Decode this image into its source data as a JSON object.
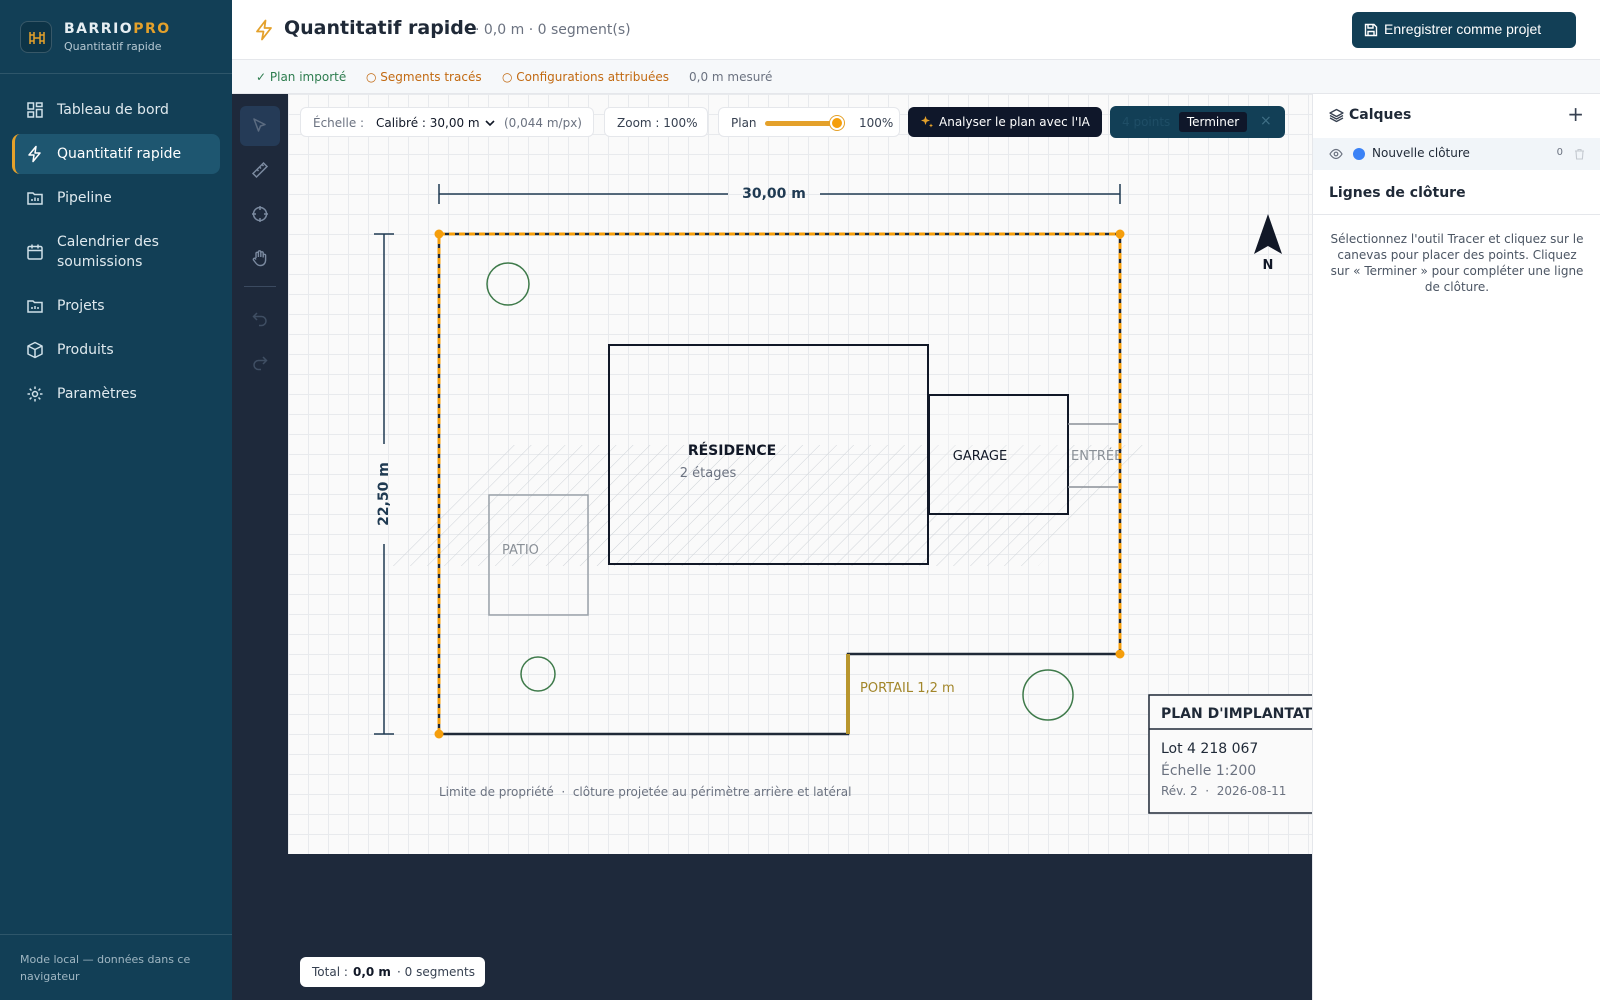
{
  "brand": {
    "name_part1": "BARRIO",
    "name_part2": "PRO",
    "subtitle": "Quantitatif rapide"
  },
  "sidebar": {
    "items": [
      {
        "label": "Tableau de bord",
        "icon": "dashboard-icon",
        "active": false
      },
      {
        "label": "Quantitatif rapide",
        "icon": "bolt-icon",
        "active": true
      },
      {
        "label": "Pipeline",
        "icon": "pipeline-icon",
        "active": false
      },
      {
        "label": "Calendrier des soumissions",
        "icon": "calendar-icon",
        "active": false
      },
      {
        "label": "Projets",
        "icon": "folder-icon",
        "active": false
      },
      {
        "label": "Produits",
        "icon": "box-icon",
        "active": false
      },
      {
        "label": "Paramètres",
        "icon": "gear-icon",
        "active": false
      }
    ],
    "footer": "Mode local — données dans ce navigateur"
  },
  "header": {
    "title": "Quantitatif rapide",
    "meta": "· 0,0 m · 0 segment(s)",
    "save_label": "Enregistrer comme projet"
  },
  "status": {
    "step1": "✓ Plan importé",
    "step2": "○ Segments tracés",
    "step3": "○ Configurations attribuées",
    "measured": "0,0 m mesuré"
  },
  "toolbar": {
    "scale_label": "Échelle :",
    "scale_value": "Calibré : 30,00 m",
    "scale_ratio": "(0,044 m/px)",
    "zoom": "Zoom : 100%",
    "plan_label": "Plan",
    "plan_opacity": "100%",
    "plan_opacity_value": 100,
    "ai_label": "Analyser le plan avec l'IA",
    "points_count": "4 points",
    "finish_label": "Terminer",
    "close_symbol": "×"
  },
  "plan": {
    "dim_horizontal": "30,00 m",
    "dim_vertical": "22,50 m",
    "north": "N",
    "residence": "RÉSIDENCE",
    "residence_floors": "2 étages",
    "patio": "PATIO",
    "garage": "GARAGE",
    "entree": "ENTRÉE",
    "portail": "PORTAIL 1,2 m",
    "legend": "Limite de propriété  ·  clôture projetée au périmètre arrière et latéral",
    "title_block": {
      "title": "PLAN D'IMPLANTATION",
      "lot": "Lot 4 218 067",
      "scale": "Échelle 1:200",
      "rev": "Rév. 2  ·  2026-08-11"
    }
  },
  "total": {
    "prefix": "Total :",
    "length": "0,0 m",
    "segments": "· 0 segments"
  },
  "layers": {
    "title": "Calques",
    "add_symbol": "+",
    "items": [
      {
        "name": "Nouvelle clôture",
        "count": "0",
        "color": "#3b82f6"
      }
    ]
  },
  "fence_lines": {
    "title": "Lignes de clôture",
    "help": "Sélectionnez l'outil Tracer et cliquez sur le canevas pour placer des points. Cliquez sur « Terminer » pour compléter une ligne de clôture."
  },
  "colors": {
    "sidebar": "#123f56",
    "accent": "#e4a12b",
    "toolstrip": "#1e293b",
    "fence": "#f59e0b"
  }
}
